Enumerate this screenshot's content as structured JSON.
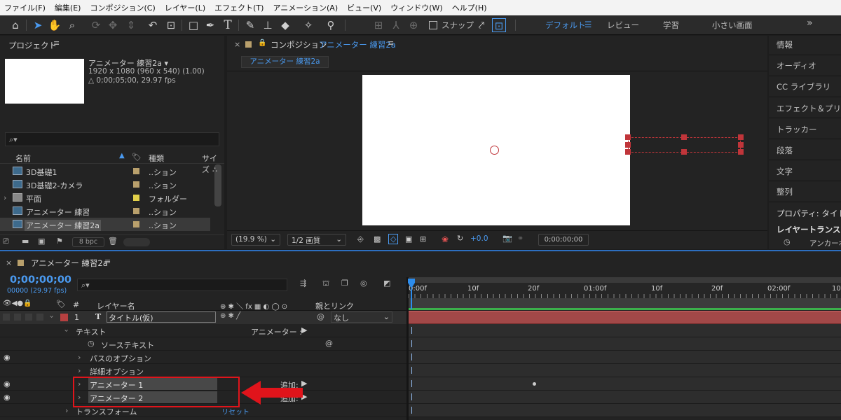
{
  "menu": [
    "ファイル(F)",
    "編集(E)",
    "コンポジション(C)",
    "レイヤー(L)",
    "エフェクト(T)",
    "アニメーション(A)",
    "ビュー(V)",
    "ウィンドウ(W)",
    "ヘルプ(H)"
  ],
  "toolbar": {
    "snap_label": "スナップ",
    "workspaces": {
      "default": "デフォルト",
      "review": "レビュー",
      "learn": "学習",
      "small": "小さい画面"
    },
    "more": "»"
  },
  "project": {
    "title": "プロジェクト",
    "comp_name": "アニメーター 練習2a ▾",
    "comp_res": "1920 x 1080 (960 x 540) (1.00)",
    "comp_dur": "△ 0;00;05;00, 29.97 fps",
    "search_placeholder": "",
    "col_name": "名前",
    "col_type": "種類",
    "col_size": "サイズ",
    "items": [
      {
        "name": "3D基礎1",
        "type": "..ション",
        "label_color": "#b9a06c",
        "kind": "comp"
      },
      {
        "name": "3D基礎2-カメラ",
        "type": "..ション",
        "label_color": "#b9a06c",
        "kind": "comp"
      },
      {
        "name": "平面",
        "type": "フォルダー",
        "label_color": "#e2d04a",
        "kind": "folder"
      },
      {
        "name": "アニメーター 練習",
        "type": "..ション",
        "label_color": "#b9a06c",
        "kind": "comp"
      },
      {
        "name": "アニメーター 練習2a",
        "type": "..ション",
        "label_color": "#b9a06c",
        "kind": "comp"
      }
    ],
    "bpc": "8 bpc"
  },
  "composition": {
    "panel_label": "コンポジション",
    "comp_link": "アニメーター 練習2a",
    "tab": "アニメーター 練習2a",
    "zoom": "(19.9 %)",
    "resolution": "1/2 画質",
    "exposure": "+0.0",
    "timecode": "0;00;00;00"
  },
  "right_panel": [
    "情報",
    "オーディオ",
    "CC ライブラリ",
    "エフェクト＆プリセット",
    "トラッカー",
    "段落",
    "文字",
    "整列",
    "プロパティ: タイトル(",
    "レイヤートランスフォ",
    "アンカーポ"
  ],
  "timeline": {
    "comp_tab": "アニメーター 練習2a",
    "timecode": "0;00;00;00",
    "frames": "00000 (29.97 fps)",
    "col_num": "#",
    "col_layer": "レイヤー名",
    "col_switches": "⊕ ✱ ＼ fx ▦ ◐ ◯ ⊙",
    "col_parent": "親とリンク",
    "ruler": [
      "0:00f",
      "10f",
      "20f",
      "01:00f",
      "10f",
      "20f",
      "02:00f",
      "10"
    ],
    "layer": {
      "num": "1",
      "type": "T",
      "name": "タイトル(仮)",
      "parent": "なし"
    },
    "props": [
      {
        "name": "テキスト",
        "indent": 1,
        "extra": "アニメーター :",
        "eye": false
      },
      {
        "name": "ソーステキスト",
        "indent": 3,
        "extra": "",
        "eye": false
      },
      {
        "name": "パスのオプション",
        "indent": 2,
        "extra": "",
        "eye": true
      },
      {
        "name": "詳細オプション",
        "indent": 2,
        "extra": "",
        "eye": false
      },
      {
        "name": "アニメーター 1",
        "indent": 2,
        "extra": "追加:",
        "eye": true
      },
      {
        "name": "アニメーター 2",
        "indent": 2,
        "extra": "追加:",
        "eye": true
      },
      {
        "name": "トランスフォーム",
        "indent": 1,
        "extra": "リセット",
        "eye": false
      }
    ]
  },
  "colors": {
    "accent": "#2d8ceb",
    "highlight_box": "#e0141b",
    "layer_bar": "#a24848",
    "green_bar": "#3bb04b"
  }
}
